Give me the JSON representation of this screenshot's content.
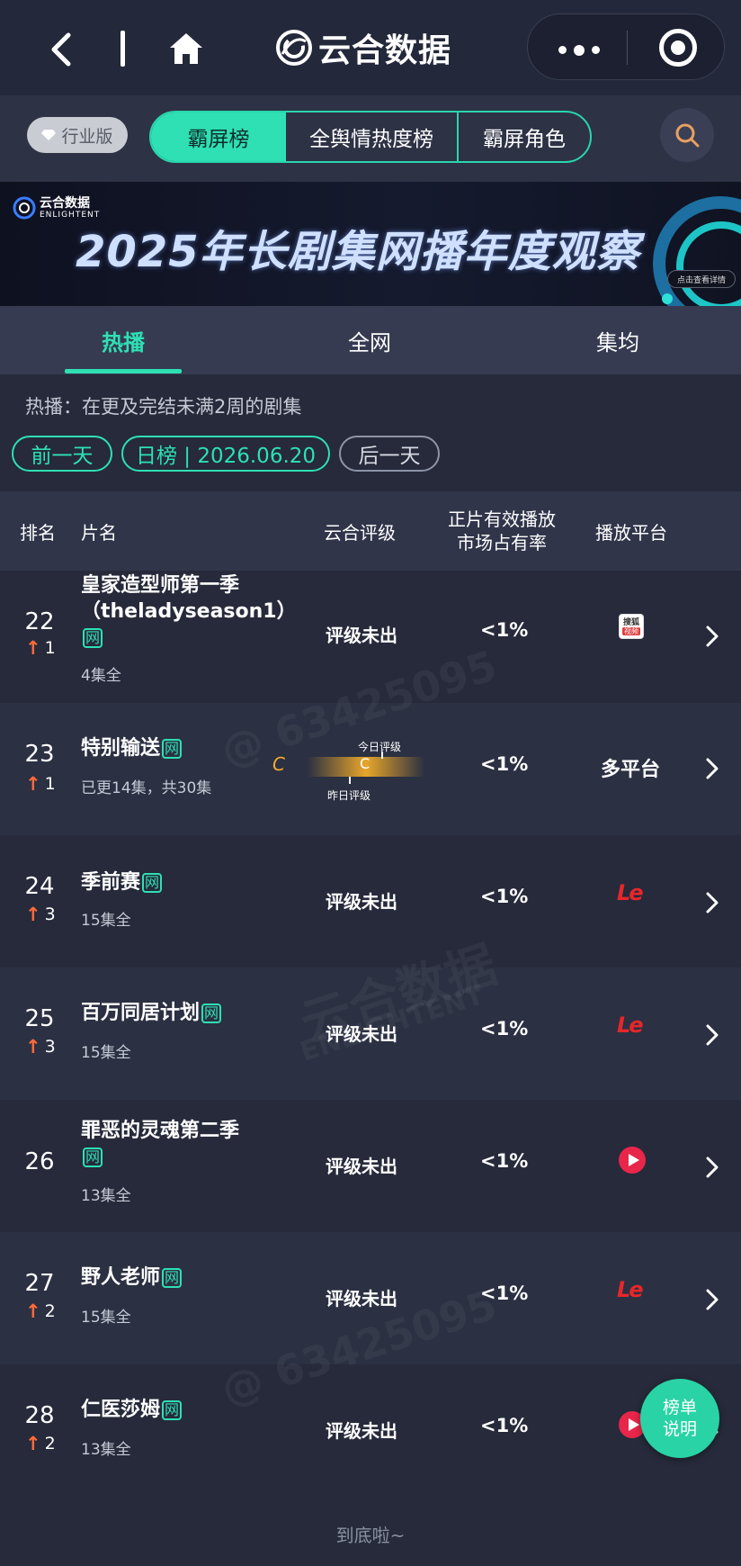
{
  "header": {
    "app_title": "云合数据"
  },
  "filters": {
    "industry_badge": "行业版",
    "segments": [
      "霸屏榜",
      "全舆情热度榜",
      "霸屏角色"
    ],
    "active_segment": "霸屏榜"
  },
  "banner": {
    "logo_cn": "云合数据",
    "logo_en": "ENLIGHTENT",
    "title": "2025年长剧集网播年度观察",
    "cta": "点击查看详情"
  },
  "tabs": {
    "items": [
      "热播",
      "全网",
      "集均"
    ],
    "active": "热播"
  },
  "description": "热播：在更及完结未满2周的剧集",
  "date_nav": {
    "prev": "前一天",
    "current": "日榜 | 2026.06.20",
    "next": "后一天"
  },
  "table": {
    "headers": {
      "rank": "排名",
      "title": "片名",
      "grade": "云合评级",
      "share": "正片有效播放市场占有率",
      "platform": "播放平台"
    },
    "rows": [
      {
        "rank": "22",
        "delta": "1",
        "title": "皇家造型师第一季（theladyseason1）",
        "tag": "网",
        "sub": "4集全",
        "grade": "评级未出",
        "share": "<1%",
        "platform": "sohu-icon"
      },
      {
        "rank": "23",
        "delta": "1",
        "title": "特别输送",
        "tag": "网",
        "sub": "已更14集，共30集",
        "grade_today": "C",
        "grade_yesterday": "C",
        "grade_today_label": "今日评级",
        "grade_yesterday_label": "昨日评级",
        "share": "<1%",
        "platform_text": "多平台"
      },
      {
        "rank": "24",
        "delta": "3",
        "title": "季前赛",
        "tag": "网",
        "sub": "15集全",
        "grade": "评级未出",
        "share": "<1%",
        "platform": "letv-icon"
      },
      {
        "rank": "25",
        "delta": "3",
        "title": "百万同居计划",
        "tag": "网",
        "sub": "15集全",
        "grade": "评级未出",
        "share": "<1%",
        "platform": "letv-icon"
      },
      {
        "rank": "26",
        "delta": "",
        "title": "罪恶的灵魂第二季",
        "tag": "网",
        "sub": "13集全",
        "grade": "评级未出",
        "share": "<1%",
        "platform": "mgtv-icon"
      },
      {
        "rank": "27",
        "delta": "2",
        "title": "野人老师",
        "tag": "网",
        "sub": "15集全",
        "grade": "评级未出",
        "share": "<1%",
        "platform": "letv-icon"
      },
      {
        "rank": "28",
        "delta": "2",
        "title": "仁医莎姆",
        "tag": "网",
        "sub": "13集全",
        "grade": "评级未出",
        "share": "<1%",
        "platform": "mgtv-icon"
      }
    ]
  },
  "platform_labels": {
    "le": "Le",
    "sohu_top": "搜狐",
    "sohu_bottom": "视频"
  },
  "float_button": "榜单说明",
  "footer": "到底啦~",
  "watermarks": {
    "id": "@ 63425095",
    "brand": "云合数据",
    "brand_en": "ENLIGHTENT"
  },
  "colors": {
    "accent": "#2ee0b4",
    "up_arrow": "#ff6b3a",
    "background": "#262a3a"
  }
}
